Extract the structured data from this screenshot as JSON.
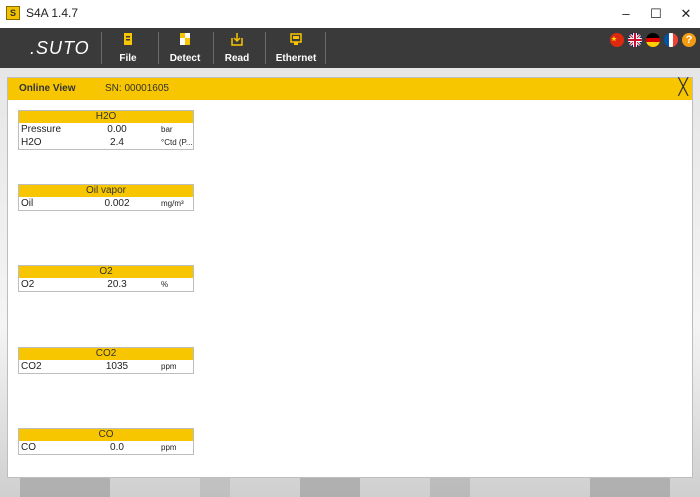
{
  "window": {
    "app_icon_text": "S",
    "title": "S4A  1.4.7",
    "minimize": "–",
    "maximize": "☐",
    "close": "✕"
  },
  "toolbar": {
    "logo": ".SUTO",
    "items": [
      {
        "label": "File",
        "icon": "file-icon"
      },
      {
        "label": "Detect",
        "icon": "detect-icon"
      },
      {
        "label": "Read",
        "icon": "read-icon"
      },
      {
        "label": "Ethernet",
        "icon": "ethernet-icon"
      }
    ],
    "flags": [
      "china-flag-icon",
      "uk-flag-icon",
      "germany-flag-icon",
      "france-flag-icon"
    ],
    "help": "?"
  },
  "panel": {
    "title": "Online View",
    "serial": "SN: 00001605",
    "close": "╳"
  },
  "sensors": [
    {
      "name": "H2O",
      "rows": [
        {
          "label": "Pressure",
          "value": "0.00",
          "unit": "bar"
        },
        {
          "label": "H2O",
          "value": "2.4",
          "unit": "°Ctd (P..."
        }
      ]
    },
    {
      "name": "Oil vapor",
      "rows": [
        {
          "label": "Oil",
          "value": "0.002",
          "unit": "mg/m³"
        }
      ]
    },
    {
      "name": "O2",
      "rows": [
        {
          "label": "O2",
          "value": "20.3",
          "unit": "%"
        }
      ]
    },
    {
      "name": "CO2",
      "rows": [
        {
          "label": "CO2",
          "value": "1035",
          "unit": "ppm"
        }
      ]
    },
    {
      "name": "CO",
      "rows": [
        {
          "label": "CO",
          "value": "0.0",
          "unit": "ppm"
        }
      ]
    }
  ],
  "colors": {
    "accent": "#f7c600",
    "toolbar": "#3a3a3a"
  }
}
